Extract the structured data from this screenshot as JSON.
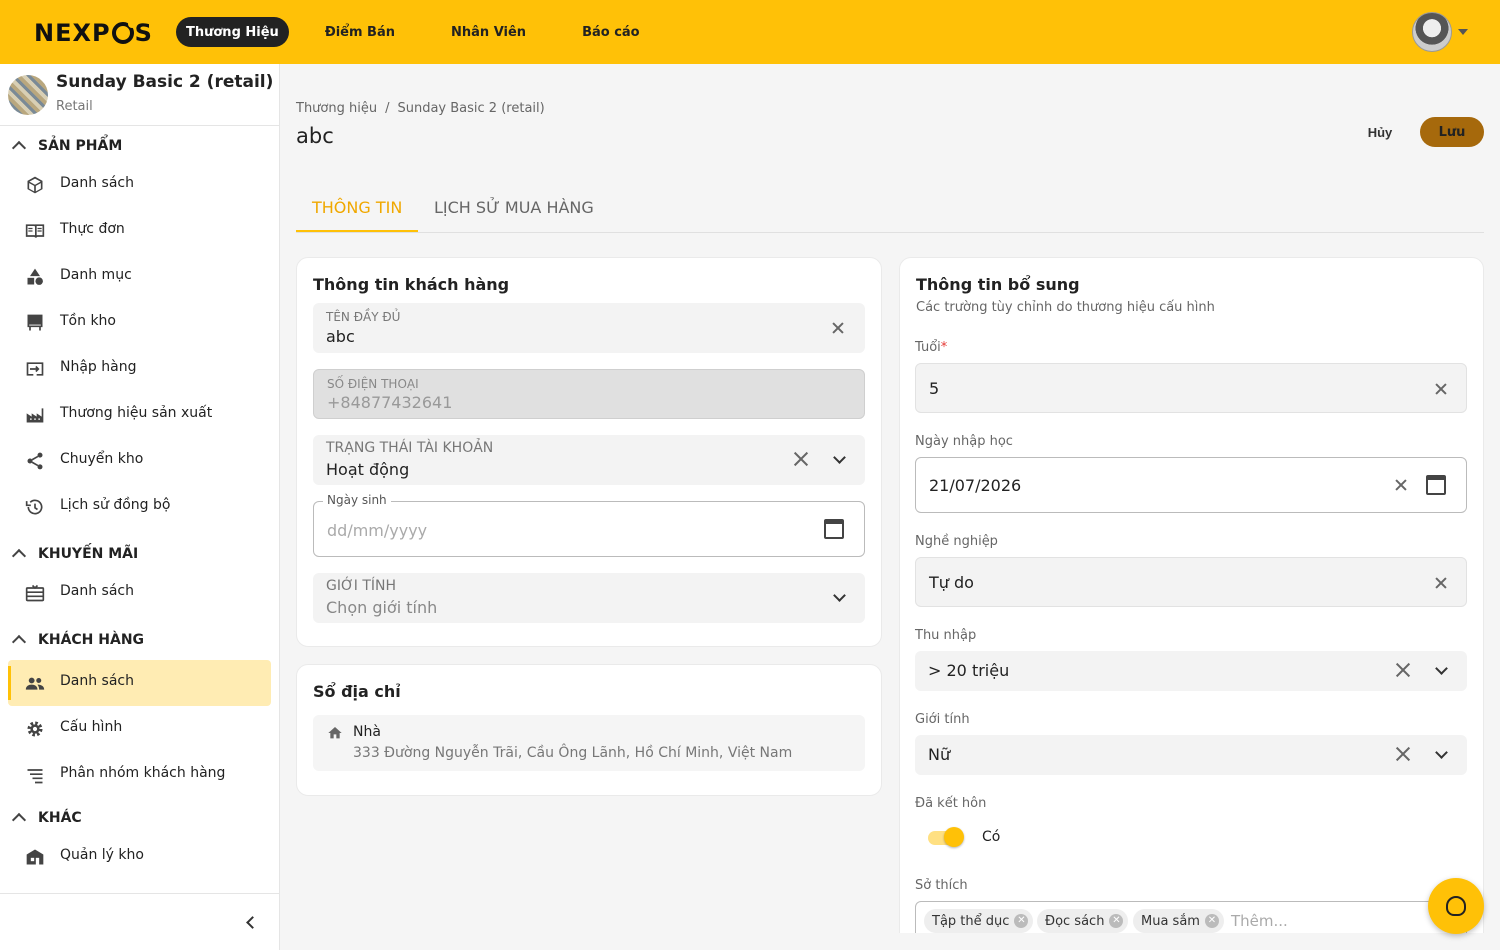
{
  "topbar": {
    "logo_left": "NEXP",
    "logo_right": "S",
    "nav": [
      "Thương Hiệu",
      "Điểm Bán",
      "Nhân Viên",
      "Báo cáo"
    ]
  },
  "sidebar": {
    "store_name": "Sunday Basic 2 (retail)",
    "store_type": "Retail",
    "sections": {
      "products": "SẢN PHẨM",
      "promotions": "KHUYẾN MÃI",
      "customers": "KHÁCH HÀNG",
      "other": "KHÁC"
    },
    "product_items": [
      "Danh sách",
      "Thực đơn",
      "Danh mục",
      "Tồn kho",
      "Nhập hàng",
      "Thương hiệu sản xuất",
      "Chuyển kho",
      "Lịch sử đồng bộ"
    ],
    "promotion_items": [
      "Danh sách"
    ],
    "customer_items": [
      "Danh sách",
      "Cấu hình",
      "Phân nhóm khách hàng"
    ],
    "other_items": [
      "Quản lý kho"
    ]
  },
  "breadcrumb": {
    "root": "Thương hiệu",
    "sep": "/",
    "current": "Sunday Basic 2 (retail)"
  },
  "page_title": "abc",
  "actions": {
    "cancel": "Hủy",
    "save": "Lưu"
  },
  "tabs": [
    "THÔNG TIN",
    "LỊCH SỬ MUA HÀNG"
  ],
  "customer_info": {
    "title": "Thông tin khách hàng",
    "full_name_label": "TÊN ĐẦY ĐỦ",
    "full_name_value": "abc",
    "phone_label": "SỐ ĐIỆN THOẠI",
    "phone_value": "+84877432641",
    "status_label": "TRẠNG THÁI TÀI KHOẢN",
    "status_value": "Hoạt động",
    "dob_label": "Ngày sinh",
    "dob_placeholder": "dd/mm/yyyy",
    "gender_label": "GIỚI TÍNH",
    "gender_placeholder": "Chọn giới tính"
  },
  "address_book": {
    "title": "Sổ địa chỉ",
    "entry_name": "Nhà",
    "entry_address": "333 Đường Nguyễn Trãi, Cầu Ông Lãnh, Hồ Chí Minh, Việt Nam"
  },
  "extra_info": {
    "title": "Thông tin bổ sung",
    "subtitle": "Các trường tùy chỉnh do thương hiệu cấu hình",
    "age_label": "Tuổi",
    "age_required": "*",
    "age_value": "5",
    "enroll_label": "Ngày nhập học",
    "enroll_value": "21/07/2026",
    "job_label": "Nghề nghiệp",
    "job_value": "Tự do",
    "income_label": "Thu nhập",
    "income_value": "> 20 triệu",
    "gender_label": "Giới tính",
    "gender_value": "Nữ",
    "married_label": "Đã kết hôn",
    "married_value": "Có",
    "hobbies_label": "Sở thích",
    "hobbies": [
      "Tập thể dục",
      "Đọc sách",
      "Mua sắm"
    ],
    "hobbies_placeholder": "Thêm..."
  },
  "colors": {
    "accent": "#FFC107",
    "save_button": "#A6690C",
    "active_item_bg": "#FFECB3"
  }
}
